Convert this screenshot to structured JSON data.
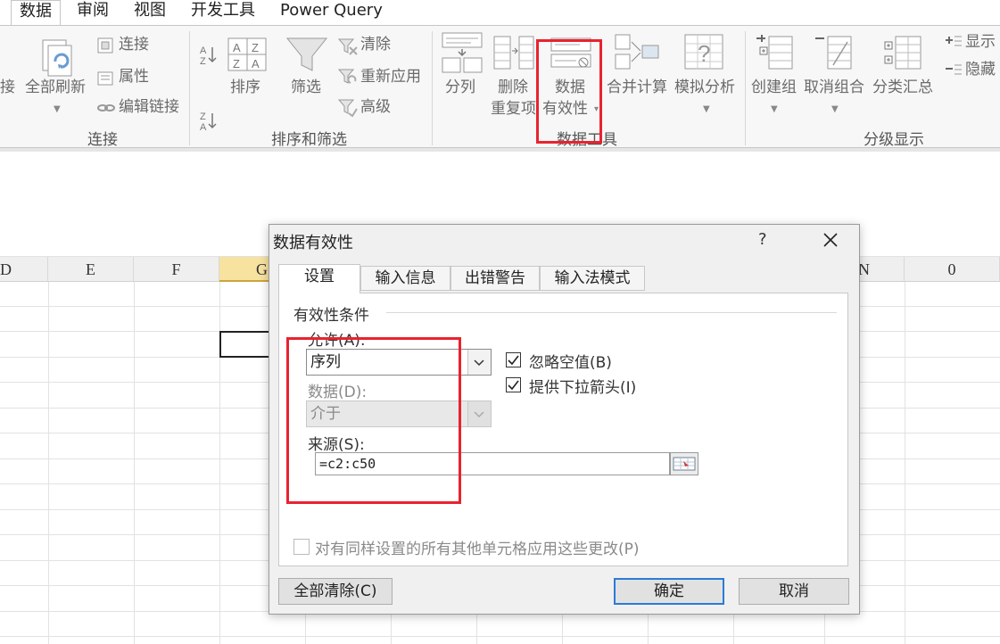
{
  "ribbon": {
    "tabs": [
      "数据",
      "审阅",
      "视图",
      "开发工具",
      "Power Query"
    ],
    "active_tab": "数据",
    "connections": {
      "partial_left": "接",
      "refresh_all": "全部刷新",
      "connect": "连接",
      "properties": "属性",
      "edit_links": "编辑链接",
      "group_label": "连接"
    },
    "sort_filter": {
      "sort": "排序",
      "filter": "筛选",
      "clear": "清除",
      "reapply": "重新应用",
      "advanced": "高级",
      "group_label": "排序和筛选"
    },
    "data_tools": {
      "text_to_columns": "分列",
      "remove_duplicates_1": "删除",
      "remove_duplicates_2": "重复项",
      "data_validation_1": "数据",
      "data_validation_2": "有效性",
      "consolidate": "合并计算",
      "what_if": "模拟分析",
      "group_label": "数据工具"
    },
    "outline": {
      "group": "创建组",
      "ungroup": "取消组合",
      "subtotal": "分类汇总",
      "show_detail": "显示",
      "hide_detail": "隐藏",
      "group_label": "分级显示"
    }
  },
  "sheet": {
    "columns": [
      "D",
      "E",
      "F",
      "G",
      "N",
      "0"
    ],
    "selected_column": "G"
  },
  "dialog": {
    "title": "数据有效性",
    "help": "?",
    "tabs": [
      "设置",
      "输入信息",
      "出错警告",
      "输入法模式"
    ],
    "active_tab": "设置",
    "section_title": "有效性条件",
    "allow_label": "允许(A):",
    "allow_value": "序列",
    "data_label": "数据(D):",
    "data_value": "介于",
    "ignore_blank": "忽略空值(B)",
    "ignore_blank_checked": true,
    "dropdown_arrow": "提供下拉箭头(I)",
    "dropdown_arrow_checked": true,
    "source_label": "来源(S):",
    "source_value": "=c2:c50",
    "apply_all": "对有同样设置的所有其他单元格应用这些更改(P)",
    "apply_all_checked": false,
    "clear_all": "全部清除(C)",
    "ok": "确定",
    "cancel": "取消"
  },
  "colors": {
    "highlight": "#e8232f",
    "selected_column": "#f7e2a0",
    "default_button_border": "#2b7bd6"
  }
}
